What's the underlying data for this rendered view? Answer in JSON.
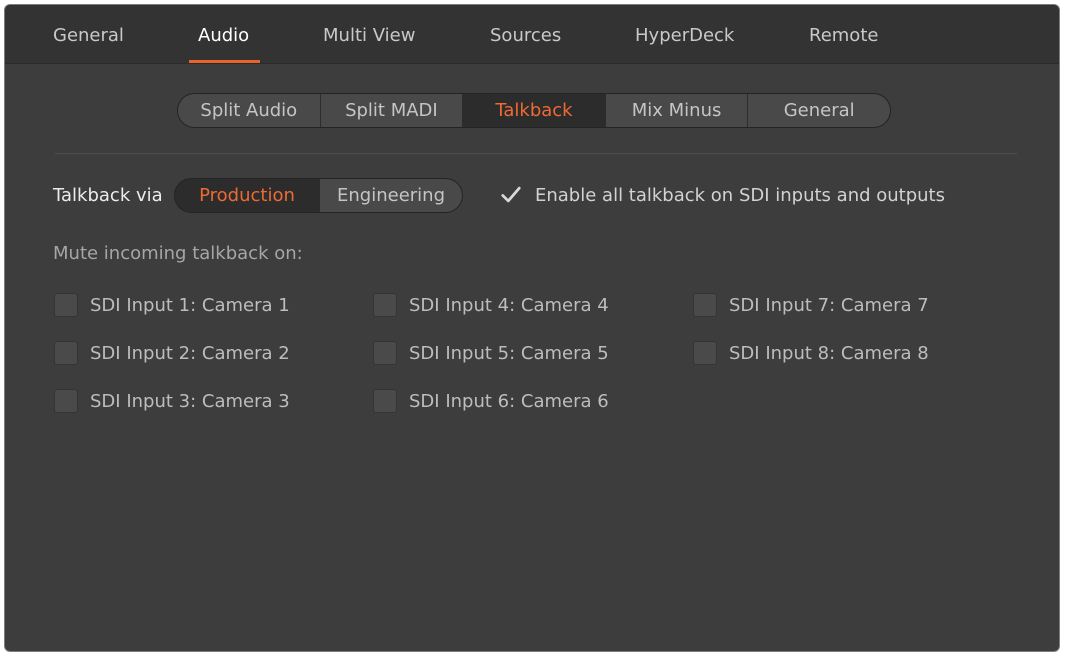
{
  "top_tabs": [
    {
      "label": "General"
    },
    {
      "label": "Audio",
      "active": true
    },
    {
      "label": "Multi View"
    },
    {
      "label": "Sources"
    },
    {
      "label": "HyperDeck"
    },
    {
      "label": "Remote"
    }
  ],
  "sub_tabs": [
    {
      "label": "Split Audio"
    },
    {
      "label": "Split MADI"
    },
    {
      "label": "Talkback",
      "active": true
    },
    {
      "label": "Mix Minus"
    },
    {
      "label": "General"
    }
  ],
  "talkback_via": {
    "label": "Talkback via",
    "options": [
      "Production",
      "Engineering"
    ],
    "selected": "Production"
  },
  "enable_all": {
    "label": "Enable all talkback on SDI inputs and outputs",
    "checked": true
  },
  "mute_section": {
    "title": "Mute incoming talkback on:",
    "inputs": [
      {
        "label": "SDI Input 1: Camera 1",
        "checked": false
      },
      {
        "label": "SDI Input 2: Camera 2",
        "checked": false
      },
      {
        "label": "SDI Input 3: Camera 3",
        "checked": false
      },
      {
        "label": "SDI Input 4: Camera 4",
        "checked": false
      },
      {
        "label": "SDI Input 5: Camera 5",
        "checked": false
      },
      {
        "label": "SDI Input 6: Camera 6",
        "checked": false
      },
      {
        "label": "SDI Input 7: Camera 7",
        "checked": false
      },
      {
        "label": "SDI Input 8: Camera 8",
        "checked": false
      }
    ]
  },
  "colors": {
    "accent": "#e8642c",
    "background": "#3d3d3d",
    "header": "#333333"
  },
  "icons": {
    "checkmark": "checkmark-icon"
  }
}
